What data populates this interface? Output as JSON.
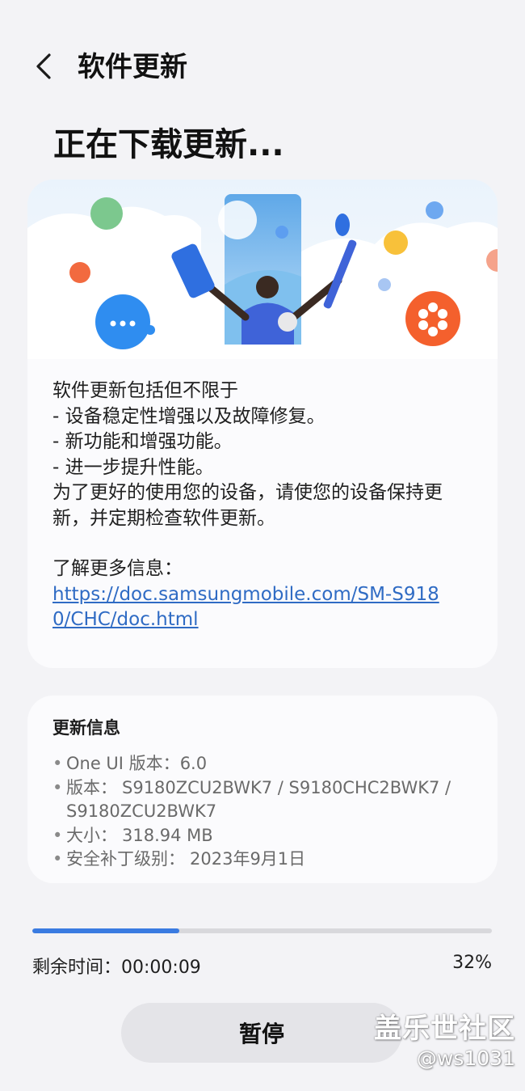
{
  "header": {
    "title": "软件更新",
    "back_icon": "chevron-left-icon"
  },
  "status": {
    "heading": "正在下载更新..."
  },
  "description": {
    "lines": [
      "软件更新包括但不限于",
      "- 设备稳定性增强以及故障修复。",
      "- 新功能和增强功能。",
      "- 进一步提升性能。",
      "为了更好的使用您的设备，请使您的设备保持更",
      "新，并定期检查软件更新。"
    ],
    "learn_more": "了解更多信息：",
    "link": "https://doc.samsungmobile.com/SM-S9180/CHC/doc.html"
  },
  "update_info": {
    "title": "更新信息",
    "items": [
      {
        "label": "One UI 版本：",
        "value": "6.0"
      },
      {
        "label": "版本：",
        "value": "S9180ZCU2BWK7 / S9180CHC2BWK7 / S9180ZCU2BWK7"
      },
      {
        "label": "大小：",
        "value": "318.94 MB"
      },
      {
        "label": "安全补丁级别：",
        "value": "2023年9月1日"
      }
    ]
  },
  "progress": {
    "fraction": 0.32,
    "remaining_label": "剩余时间：00:00:09",
    "percent_label": "32%",
    "accent_color": "#3a7be1",
    "track_color": "#d8d8dc"
  },
  "actions": {
    "pause_label": "暂停"
  },
  "watermark": {
    "site": "盖乐世社区",
    "user": "@ws1031"
  }
}
